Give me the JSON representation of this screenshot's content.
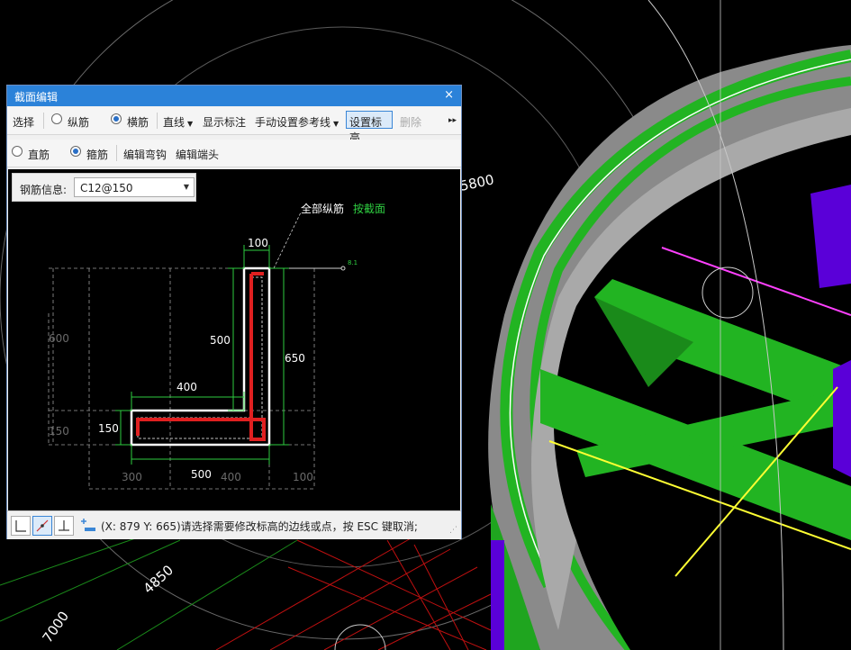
{
  "colors": {
    "ground": "#000000",
    "wall_gray": "#8a8a8a",
    "green": "#22b422",
    "purple": "#5a00d8",
    "magenta_line": "#ff40ff",
    "yellow_line": "#ffff33",
    "title_bar": "#2b82d9"
  },
  "scene": {
    "dim_labels": [
      "5800",
      "4850",
      "7000"
    ]
  },
  "dialog": {
    "title": "截面编辑",
    "close_glyph": "×",
    "toolbar1": {
      "select": "选择",
      "longitudinal": "纵筋",
      "transverse": "横筋",
      "straight_line": "直线",
      "show_dims": "显示标注",
      "manual_ref_line": "手动设置参考线",
      "set_elevation": "设置标高",
      "delete": "删除",
      "more": "▸▸"
    },
    "toolbar2": {
      "straight_bar": "直筋",
      "stirrup": "箍筋",
      "edit_hook": "编辑弯钩",
      "edit_end": "编辑端头"
    },
    "rebar_info": {
      "label": "钢筋信息:",
      "value": "C12@150"
    },
    "canvas": {
      "annotation_all_long": "全部纵筋",
      "annotation_by_section": "按截面",
      "elev_tag": "8.1",
      "dims": {
        "top_width": "100",
        "vertical_inner": "500",
        "vertical_outer": "650",
        "horizontal_upper": "400",
        "flange_height": "150",
        "bottom_width": "500",
        "left_600": "600",
        "left_150": "150",
        "bottom_300": "300",
        "bottom_400": "400",
        "bottom_100": "100"
      }
    },
    "status_text": "(X: 879 Y: 665)请选择需要修改标高的边线或点，按 ESC 键取消;"
  }
}
